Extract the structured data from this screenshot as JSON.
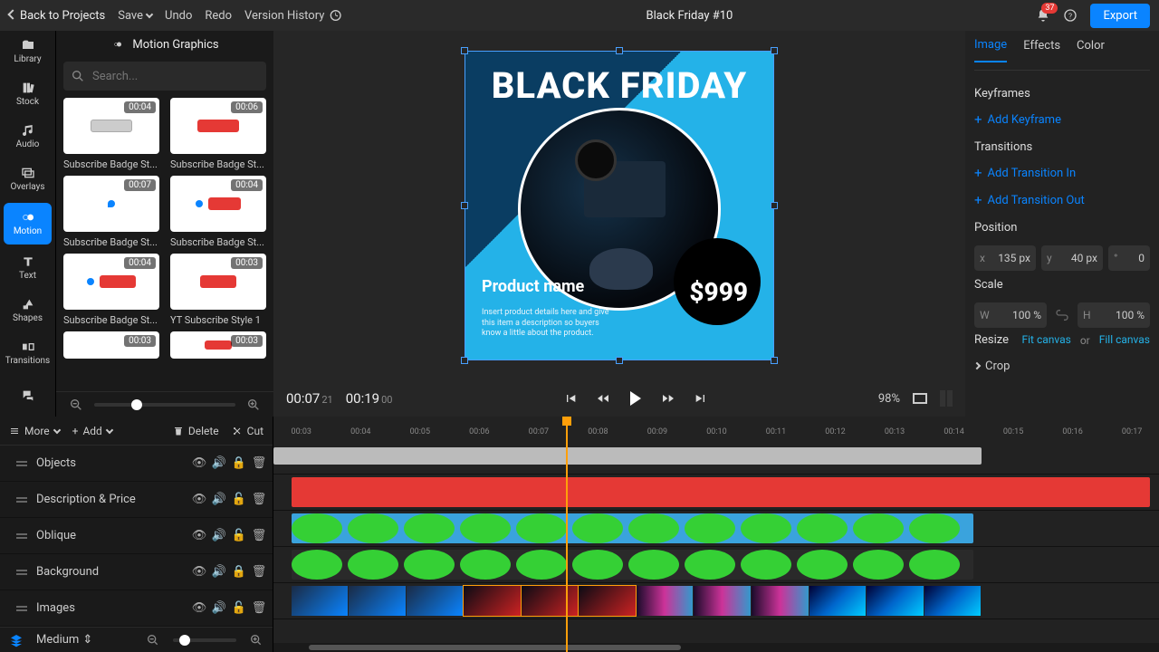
{
  "topbar": {
    "back": "Back to Projects",
    "save": "Save",
    "undo": "Undo",
    "redo": "Redo",
    "history": "Version History",
    "title": "Black Friday #10",
    "notif_count": "37",
    "export": "Export"
  },
  "rail": {
    "library": "Library",
    "stock": "Stock",
    "audio": "Audio",
    "overlays": "Overlays",
    "motion": "Motion",
    "text": "Text",
    "shapes": "Shapes",
    "transitions": "Transitions"
  },
  "library": {
    "title": "Motion Graphics",
    "search_placeholder": "Search...",
    "items": [
      {
        "dur": "00:04",
        "label": "Subscribe Badge St..."
      },
      {
        "dur": "00:06",
        "label": "Subscribe Badge St..."
      },
      {
        "dur": "00:07",
        "label": "Subscribe Badge St..."
      },
      {
        "dur": "00:04",
        "label": "Subscribe Badge St..."
      },
      {
        "dur": "00:04",
        "label": "Subscribe Badge St..."
      },
      {
        "dur": "00:03",
        "label": "YT Subscribe Style 1"
      },
      {
        "dur": "00:03",
        "label": ""
      },
      {
        "dur": "00:03",
        "label": ""
      }
    ]
  },
  "canvas": {
    "bf_title": "BLACK FRIDAY",
    "product_name": "Product name",
    "description": "Insert product details here and give this item a description so buyers know a little about the product.",
    "price": "$999"
  },
  "transport": {
    "cur_s": "00:07",
    "cur_f": "21",
    "dur_s": "00:19",
    "dur_f": "00",
    "zoom": "98%"
  },
  "inspector": {
    "tabs": {
      "image": "Image",
      "effects": "Effects",
      "color": "Color"
    },
    "keyframes_h": "Keyframes",
    "add_keyframe": "Add Keyframe",
    "transitions_h": "Transitions",
    "add_in": "Add Transition In",
    "add_out": "Add Transition Out",
    "position_h": "Position",
    "pos_x": "135 px",
    "pos_y": "40 px",
    "rot": "0",
    "scale_h": "Scale",
    "scale_w": "100 %",
    "scale_h_val": "100 %",
    "resize_h": "Resize",
    "fit": "Fit canvas",
    "or": "or",
    "fill": "Fill canvas",
    "crop": "Crop"
  },
  "timeline": {
    "more": "More",
    "add": "Add",
    "delete": "Delete",
    "cut": "Cut",
    "layers": [
      "Objects",
      "Description & Price",
      "Oblique",
      "Background",
      "Images"
    ],
    "ticks": [
      "00:03",
      "00:04",
      "00:05",
      "00:06",
      "00:07",
      "00:08",
      "00:09",
      "00:10",
      "00:11",
      "00:12",
      "00:13",
      "00:14",
      "00:15",
      "00:16",
      "00:17"
    ],
    "footer_size": "Medium"
  }
}
